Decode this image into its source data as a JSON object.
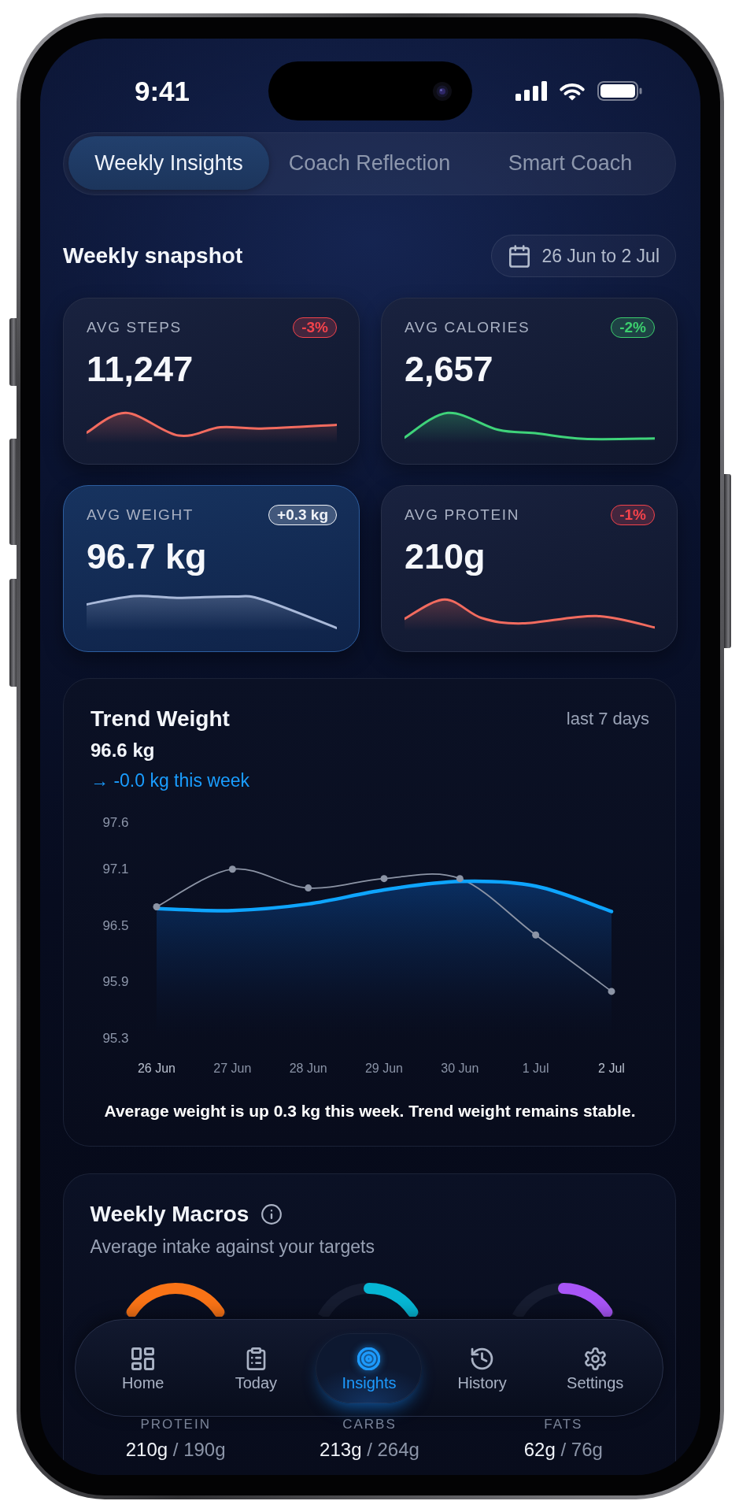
{
  "status_bar": {
    "time": "9:41"
  },
  "tabs": [
    {
      "label": "Weekly Insights",
      "selected": true
    },
    {
      "label": "Coach Reflection",
      "selected": false
    },
    {
      "label": "Smart Coach",
      "selected": false
    }
  ],
  "snapshot": {
    "title": "Weekly snapshot",
    "date_range": "26 Jun to 2 Jul",
    "metrics": [
      {
        "label": "AVG STEPS",
        "value": "11,247",
        "badge": {
          "text": "-3%",
          "color": "#f4434b"
        },
        "color": "#f26b5f",
        "selected": false
      },
      {
        "label": "AVG CALORIES",
        "value": "2,657",
        "badge": {
          "text": "-2%",
          "color": "#3ccf6e"
        },
        "color": "#3fd37a",
        "selected": false
      },
      {
        "label": "AVG WEIGHT",
        "value": "96.7 kg",
        "badge": {
          "text": "+0.3 kg",
          "color": "#f0f3f8"
        },
        "color": "#a9b9d9",
        "selected": true
      },
      {
        "label": "AVG PROTEIN",
        "value": "210g",
        "badge": {
          "text": "-1%",
          "color": "#f4434b"
        },
        "color": "#f26b5f",
        "selected": false
      }
    ]
  },
  "trend_weight": {
    "title": "Trend Weight",
    "period": "last 7 days",
    "value": "96.6 kg",
    "change": "→ -0.0 kg this week",
    "chart_data": {
      "type": "line",
      "categories": [
        "26 Jun",
        "27 Jun",
        "28 Jun",
        "29 Jun",
        "30 Jun",
        "1 Jul",
        "2 Jul"
      ],
      "series": [
        {
          "type": "line",
          "marker": "circle",
          "color": "#8c94a5",
          "values": [
            96.7,
            97.1,
            96.9,
            97.0,
            97.0,
            96.4,
            95.8
          ]
        },
        {
          "type": "area",
          "color": "#0ea5ff",
          "values": [
            96.68,
            96.66,
            96.73,
            96.88,
            96.97,
            96.92,
            96.65
          ]
        }
      ],
      "ylim": [
        95.3,
        97.6
      ],
      "yticks": [
        97.6,
        97.1,
        96.5,
        95.9,
        95.3
      ]
    },
    "summary": "Average weight is up 0.3 kg this week. Trend weight remains stable."
  },
  "weekly_macros": {
    "title": "Weekly Macros",
    "subtitle": "Average intake against your targets",
    "macros": [
      {
        "label": "PROTEIN",
        "intake": "210g",
        "separator": "/",
        "target": "190g",
        "level": 1,
        "color": "#f97316"
      },
      {
        "label": "CARBS",
        "intake": "213g",
        "separator": "/",
        "target": "264g",
        "level": 0.5,
        "color": "#06b6d4"
      },
      {
        "label": "FATS",
        "intake": "62g",
        "separator": "/",
        "target": "76g",
        "level": 0.5,
        "color": "#a855f7"
      }
    ]
  },
  "bottom_nav": [
    {
      "label": "Home",
      "selected": false
    },
    {
      "label": "Today",
      "selected": false
    },
    {
      "label": "Insights",
      "selected": true
    },
    {
      "label": "History",
      "selected": false
    },
    {
      "label": "Settings",
      "selected": false
    }
  ]
}
